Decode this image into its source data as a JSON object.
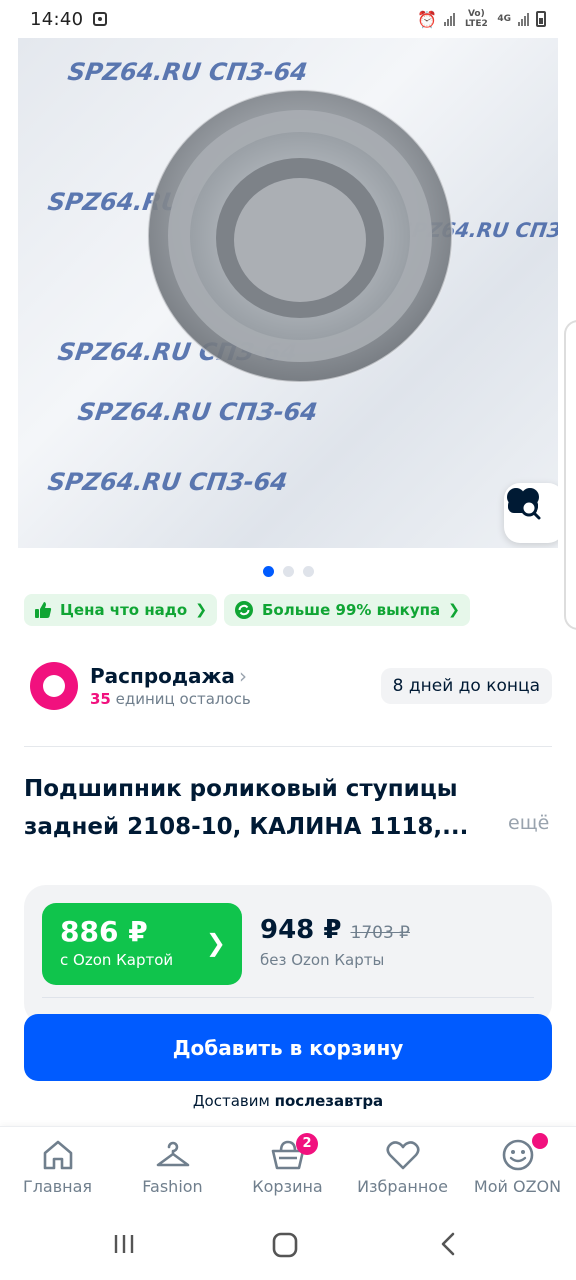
{
  "status_bar": {
    "time": "14:40",
    "network_labels": [
      "Vo) LTE2",
      "4G"
    ]
  },
  "gallery": {
    "image_description": "wheel bearing in plastic packaging",
    "package_print": "SPZ64.RU СПЗ-64",
    "pages": 3,
    "active_page": 1,
    "lens_icon": "image-search-icon"
  },
  "chips": [
    {
      "icon": "thumb-up-icon",
      "label": "Цена что надо"
    },
    {
      "icon": "refresh-check-icon",
      "label": "Больше 99% выкупа"
    }
  ],
  "sale": {
    "title": "Распродажа",
    "count": "35",
    "remaining_text": "единиц осталось",
    "badge": "8 дней до конца"
  },
  "product": {
    "title_line1": "Подшипник роликовый ступицы",
    "title_line2": "задней 2108-10, КАЛИНА 1118,...",
    "more": "ещё"
  },
  "price": {
    "card_price": "886 ₽",
    "card_label": "с Ozon Картой",
    "regular_price": "948 ₽",
    "old_price": "1703 ₽",
    "regular_label": "без Ozon Карты"
  },
  "cart_button": "Добавить в корзину",
  "delivery": {
    "prefix": "Доставим",
    "when": "послезавтра"
  },
  "bottom_nav": [
    {
      "label": "Главная",
      "icon": "home-icon"
    },
    {
      "label": "Fashion",
      "icon": "hanger-icon"
    },
    {
      "label": "Корзина",
      "icon": "basket-icon",
      "badge": "2"
    },
    {
      "label": "Избранное",
      "icon": "heart-icon"
    },
    {
      "label": "Мой OZON",
      "icon": "smile-icon"
    }
  ],
  "colors": {
    "brand_blue": "#005bff",
    "green": "#10c44c",
    "pink": "#f1117e"
  }
}
